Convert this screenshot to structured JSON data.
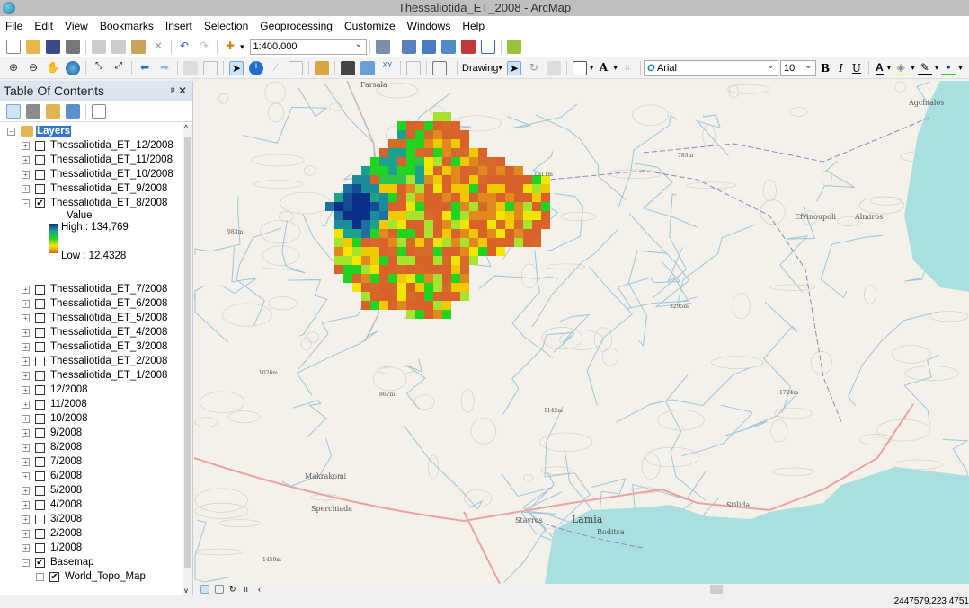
{
  "window": {
    "title": "Thessaliotida_ET_2008 - ArcMap"
  },
  "menu": [
    "File",
    "Edit",
    "View",
    "Bookmarks",
    "Insert",
    "Selection",
    "Geoprocessing",
    "Customize",
    "Windows",
    "Help"
  ],
  "toolbar": {
    "scale": "1:400.000",
    "drawing_label": "Drawing",
    "font": "Arial",
    "font_size": "10",
    "bold": "B",
    "italic": "I",
    "underline": "U",
    "font_color_glyph": "A"
  },
  "toc": {
    "title": "Table Of Contents",
    "pin": "ᵖ",
    "close": "✕",
    "root": "Layers",
    "layers_top": [
      {
        "name": "Thessaliotida_ET_12/2008",
        "checked": false
      },
      {
        "name": "Thessaliotida_ET_11/2008",
        "checked": false
      },
      {
        "name": "Thessaliotida_ET_10/2008",
        "checked": false
      },
      {
        "name": "Thessaliotida_ET_9/2008",
        "checked": false
      },
      {
        "name": "Thessaliotida_ET_8/2008",
        "checked": true
      }
    ],
    "legend": {
      "field": "Value",
      "high": "High : 134,769",
      "low": "Low : 12,4328"
    },
    "layers_bottom": [
      {
        "name": "Thessaliotida_ET_7/2008"
      },
      {
        "name": "Thessaliotida_ET_6/2008"
      },
      {
        "name": "Thessaliotida_ET_5/2008"
      },
      {
        "name": "Thessaliotida_ET_4/2008"
      },
      {
        "name": "Thessaliotida_ET_3/2008"
      },
      {
        "name": "Thessaliotida_ET_2/2008"
      },
      {
        "name": "Thessaliotida_ET_1/2008"
      },
      {
        "name": "12/2008"
      },
      {
        "name": "11/2008"
      },
      {
        "name": "10/2008"
      },
      {
        "name": "9/2008"
      },
      {
        "name": "8/2008"
      },
      {
        "name": "7/2008"
      },
      {
        "name": "6/2008"
      },
      {
        "name": "5/2008"
      },
      {
        "name": "4/2008"
      },
      {
        "name": "3/2008"
      },
      {
        "name": "2/2008"
      },
      {
        "name": "1/2008"
      }
    ],
    "basemap": "Basemap",
    "basemap_layer": "World_Topo_Map"
  },
  "map": {
    "labels": [
      "Farsala",
      "Agchialos",
      "Almiros",
      "Efvinoupoli",
      "Makrakomi",
      "Sperchiada",
      "Stavros",
      "Lamia",
      "Roditsa",
      "Stilida"
    ],
    "elevations": [
      "1011m",
      "783m",
      "983m",
      "3295m",
      "1026m",
      "867m",
      "1142m",
      "1724m",
      "1459m"
    ]
  },
  "status": {
    "coordinates": "2447579,223  4751"
  },
  "colors": {
    "water": "#aadfe0",
    "land": "#f4f1ea",
    "streams": "#9cc6dc",
    "raster_high": "#0b2f86",
    "raster_mid": "#22d422",
    "raster_low": "#d9622b"
  }
}
